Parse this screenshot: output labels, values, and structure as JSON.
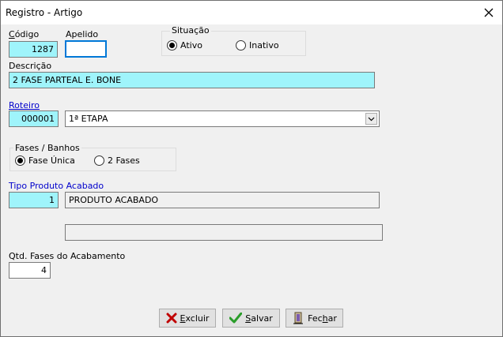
{
  "window": {
    "title": "Registro - Artigo"
  },
  "codigo": {
    "label": "Código",
    "value": "1287"
  },
  "apelido": {
    "label": "Apelido",
    "value": ""
  },
  "situacao": {
    "title": "Situação",
    "options": [
      {
        "label": "Ativo",
        "selected": true
      },
      {
        "label": "Inativo",
        "selected": false
      }
    ]
  },
  "descricao": {
    "label": "Descrição",
    "value": "2 FASE PARTEAL E. BONE"
  },
  "roteiro": {
    "label": "Roteiro",
    "code": "000001",
    "selected": "1ª ETAPA"
  },
  "fases": {
    "title": "Fases / Banhos",
    "options": [
      {
        "label": "Fase Única",
        "selected": true
      },
      {
        "label": "2 Fases",
        "selected": false
      }
    ]
  },
  "tipo_produto": {
    "label": "Tipo Produto Acabado",
    "code": "1",
    "name": "PRODUTO ACABADO",
    "extra": ""
  },
  "qtd_fases": {
    "label": "Qtd. Fases do Acabamento",
    "value": "4"
  },
  "buttons": {
    "excluir": {
      "mnemonic": "E",
      "rest": "xcluir"
    },
    "salvar": {
      "mnemonic": "S",
      "rest": "alvar"
    },
    "fechar": {
      "prefix": "Fec",
      "mnemonic": "h",
      "rest": "ar"
    }
  },
  "colors": {
    "cyan_field": "#9ff4fb",
    "focus_border": "#0078d7",
    "link": "#0000cc",
    "delete_red": "#c00000",
    "save_green": "#2a9d2a"
  },
  "icons": {
    "close": "close-icon",
    "delete": "x-icon",
    "save": "check-icon",
    "close_door": "door-exit-icon",
    "dropdown": "chevron-down-icon"
  }
}
